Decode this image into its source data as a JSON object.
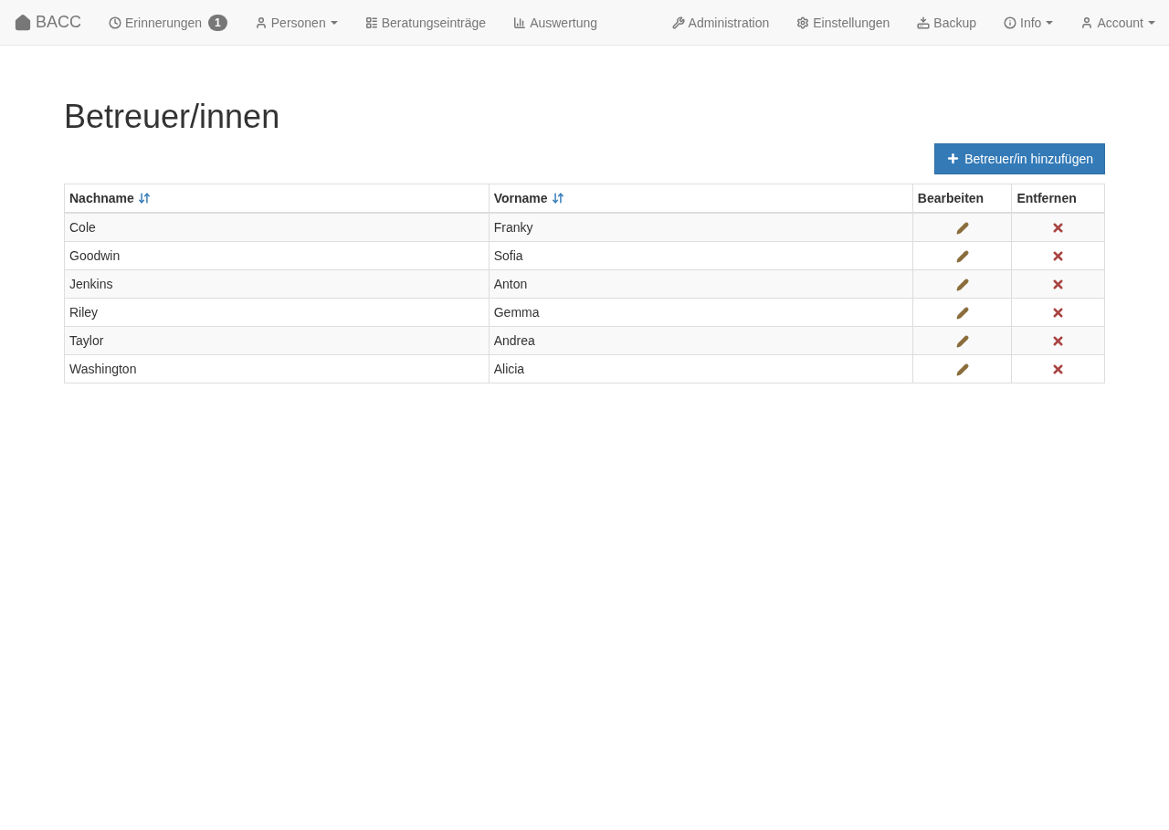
{
  "navbar": {
    "brand": "BACC",
    "left_items": [
      {
        "label": "Erinnerungen",
        "badge": "1",
        "dropdown": false
      },
      {
        "label": "Personen",
        "dropdown": true
      },
      {
        "label": "Beratungseinträge",
        "dropdown": false
      },
      {
        "label": "Auswertung",
        "dropdown": false
      }
    ],
    "right_items": [
      {
        "label": "Administration",
        "dropdown": false
      },
      {
        "label": "Einstellungen",
        "dropdown": false
      },
      {
        "label": "Backup",
        "dropdown": false
      },
      {
        "label": "Info",
        "dropdown": true
      },
      {
        "label": "Account",
        "dropdown": true
      }
    ]
  },
  "page": {
    "title": "Betreuer/innen",
    "add_button": "Betreuer/in hinzufügen"
  },
  "table": {
    "columns": [
      {
        "label": "Nachname",
        "sortable": true
      },
      {
        "label": "Vorname",
        "sortable": true
      },
      {
        "label": "Bearbeiten",
        "sortable": false
      },
      {
        "label": "Entfernen",
        "sortable": false
      }
    ],
    "rows": [
      {
        "nachname": "Cole",
        "vorname": "Franky"
      },
      {
        "nachname": "Goodwin",
        "vorname": "Sofia"
      },
      {
        "nachname": "Jenkins",
        "vorname": "Anton"
      },
      {
        "nachname": "Riley",
        "vorname": "Gemma"
      },
      {
        "nachname": "Taylor",
        "vorname": "Andrea"
      },
      {
        "nachname": "Washington",
        "vorname": "Alicia"
      }
    ]
  }
}
